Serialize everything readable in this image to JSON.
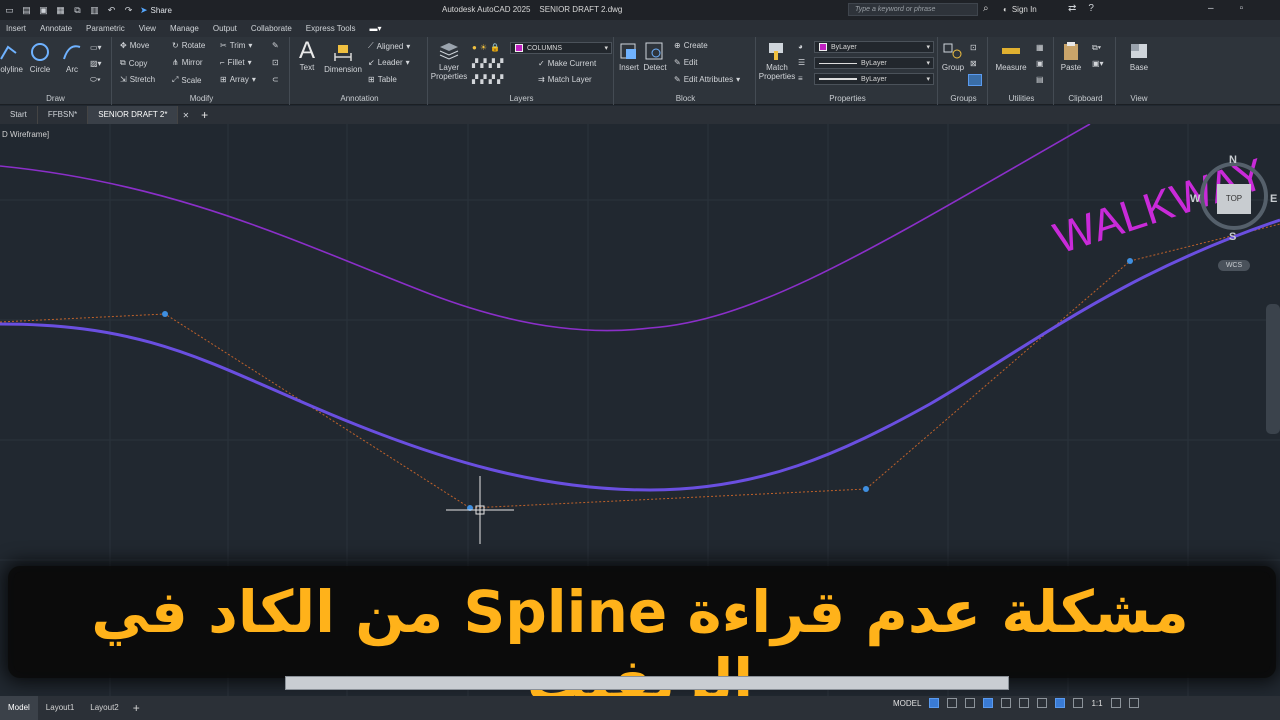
{
  "titlebar": {
    "share_label": "Share",
    "app_title": "Autodesk AutoCAD 2025    SENIOR DRAFT 2.dwg",
    "search_placeholder": "Type a keyword or phrase",
    "signin_label": "Sign In"
  },
  "menu": [
    "Insert",
    "Annotate",
    "Parametric",
    "View",
    "Manage",
    "Output",
    "Collaborate",
    "Express Tools"
  ],
  "ribbon": {
    "draw": {
      "title": "Draw",
      "polyline": "Polyline",
      "circle": "Circle",
      "arc": "Arc"
    },
    "modify": {
      "title": "Modify",
      "move": "Move",
      "rotate": "Rotate",
      "trim": "Trim",
      "copy": "Copy",
      "mirror": "Mirror",
      "fillet": "Fillet",
      "stretch": "Stretch",
      "scale": "Scale",
      "array": "Array"
    },
    "annotation": {
      "title": "Annotation",
      "text": "Text",
      "dimension": "Dimension",
      "aligned": "Aligned",
      "leader": "Leader",
      "table": "Table"
    },
    "layers": {
      "title": "Layers",
      "layer_properties": "Layer Properties",
      "current_layer": "COLUMNS",
      "make_current": "Make Current",
      "match_layer": "Match Layer"
    },
    "block": {
      "title": "Block",
      "insert": "Insert",
      "detect": "Detect",
      "create": "Create",
      "edit": "Edit",
      "edit_attributes": "Edit Attributes"
    },
    "properties": {
      "title": "Properties",
      "match_properties": "Match Properties",
      "color": "ByLayer",
      "linetype": "ByLayer",
      "lineweight": "ByLayer"
    },
    "groups": {
      "title": "Groups",
      "group": "Group"
    },
    "utilities": {
      "title": "Utilities",
      "measure": "Measure"
    },
    "clipboard": {
      "title": "Clipboard",
      "paste": "Paste"
    },
    "view": {
      "title": "View",
      "base": "Base"
    }
  },
  "doctabs": [
    "Start",
    "FFBSN*",
    "SENIOR DRAFT 2*"
  ],
  "viewport_label": "D Wireframe]",
  "viewcube": {
    "top": "TOP",
    "north": "N",
    "south": "S",
    "east": "E",
    "west": "W",
    "wcs": "WCS"
  },
  "drawing_text": {
    "walkway": "WALKWAY"
  },
  "overlay_title": "مشكلة عدم قراءة Spline من الكاد في الريفيت",
  "layouttabs": [
    "Model",
    "Layout1",
    "Layout2"
  ],
  "status": {
    "model_label": "MODEL",
    "scale": "1:1"
  },
  "colors": {
    "accent": "#ffb21a",
    "spline": "#6a4fe0",
    "purple_line": "#8b2fc9",
    "control_polygon": "#c0622a"
  }
}
